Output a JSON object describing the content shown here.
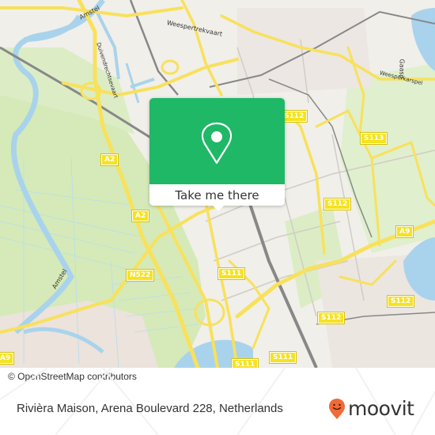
{
  "map": {
    "attribution": "© OpenStreetMap contributors",
    "street_names": [
      "Amstel",
      "Duivendrechtsevaart",
      "Weespertrekvaart",
      "Gaasp",
      "Weesperkarspel",
      "Amstel"
    ],
    "road_shields": [
      "A2",
      "A2",
      "N522",
      "S111",
      "S111",
      "S111",
      "S112",
      "S112",
      "S112",
      "S112",
      "S112",
      "S113",
      "A9",
      "A9"
    ],
    "colors": {
      "land": "#f1efea",
      "green": "#cfe8b0",
      "water": "#a9d3ec",
      "major_road": "#f8e15b",
      "rail": "#888888"
    }
  },
  "popup": {
    "icon": "map-pin-icon",
    "button_label": "Take me there",
    "color": "#1fb866"
  },
  "footer": {
    "address": "Rivièra Maison, Arena Boulevard 228, Netherlands",
    "logo_text": "moovit",
    "logo_icon": "moovit-smiley-pin-icon",
    "logo_color": "#f26a35"
  }
}
